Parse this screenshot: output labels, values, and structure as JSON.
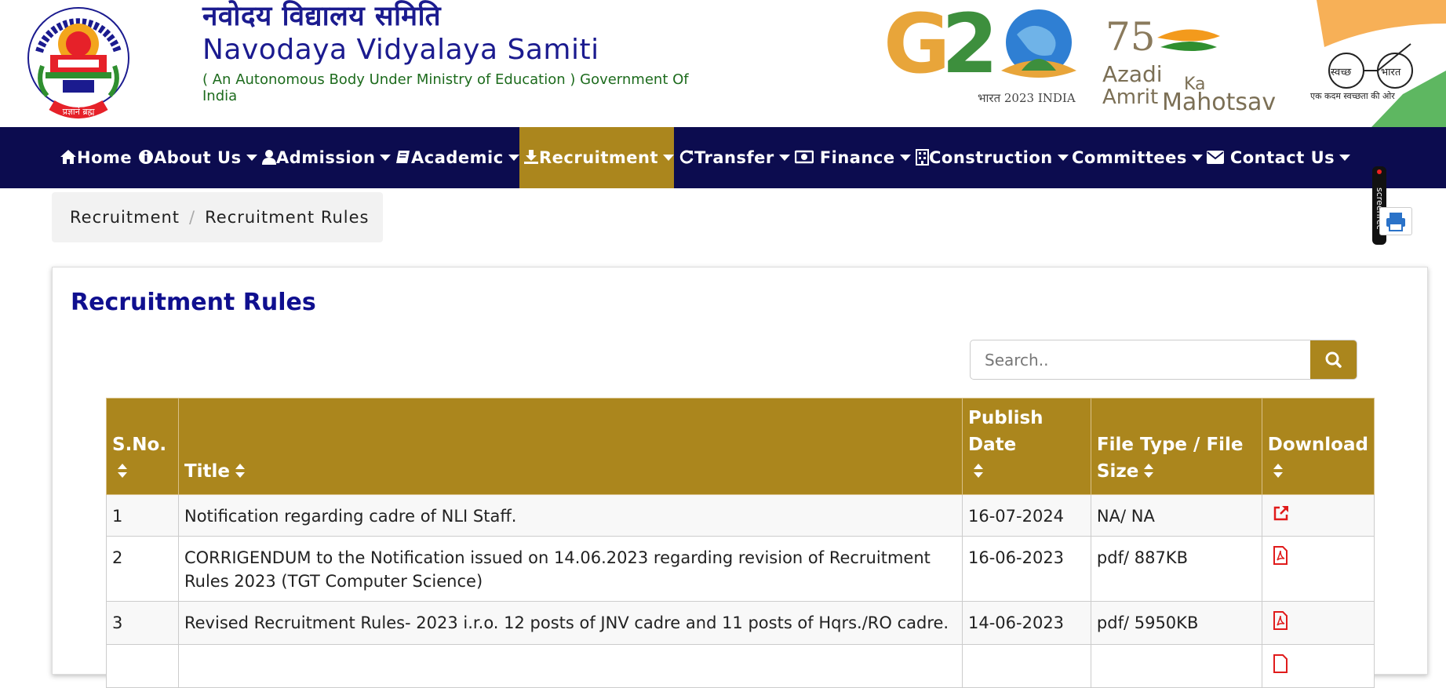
{
  "header": {
    "hindi_title": "नवोदय विद्यालय समिति",
    "english_title": "Navodaya Vidyalaya Samiti",
    "subtitle": "( An Autonomous Body Under Ministry of Education ) Government Of India",
    "emblem_motto": "प्रज्ञानं ब्रह्म",
    "emblem_ring_text": "नवोदय विद्यालय समिति",
    "g20_caption": "भारत 2023 INDIA",
    "azadi_text": [
      "Azadi",
      "Ka",
      "Amrit",
      "Mahotsav"
    ],
    "azadi_number": "75",
    "swachh_text": [
      "स्वच्छ",
      "भारत"
    ],
    "swachh_tagline": "एक कदम स्वच्छता की ओर"
  },
  "nav": {
    "items": [
      {
        "label": "Home",
        "icon": "home-icon",
        "has_caret": false
      },
      {
        "label": "About Us",
        "icon": "info-icon",
        "has_caret": true
      },
      {
        "label": "Admission",
        "icon": "user-icon",
        "has_caret": true
      },
      {
        "label": "Academic",
        "icon": "book-icon",
        "has_caret": true
      },
      {
        "label": "Recruitment",
        "icon": "download-icon",
        "has_caret": true,
        "active": true
      },
      {
        "label": "Transfer",
        "icon": "refresh-icon",
        "has_caret": true
      },
      {
        "label": "Finance",
        "icon": "money-icon",
        "has_caret": true
      },
      {
        "label": "Construction",
        "icon": "building-icon",
        "has_caret": true
      },
      {
        "label": "Committees",
        "icon": "",
        "has_caret": true
      },
      {
        "label": "Contact Us",
        "icon": "envelope-icon",
        "has_caret": true
      }
    ],
    "active_color": "#ab861d",
    "bg_color": "#0c0c4f"
  },
  "breadcrumb": {
    "items": [
      "Recruitment",
      "Recruitment Rules"
    ],
    "separator": "/"
  },
  "screenrec": {
    "label": "screenrec"
  },
  "main": {
    "title": "Recruitment Rules",
    "search": {
      "placeholder": "Search..",
      "value": ""
    },
    "table": {
      "columns": [
        "S.No.",
        "Title",
        "Publish Date",
        "File Type / File Size",
        "Download"
      ],
      "rows": [
        {
          "sno": "1",
          "title": "Notification regarding cadre of NLI Staff.",
          "date": "16-07-2024",
          "file": "NA/ NA",
          "download_icon": "external-link-icon"
        },
        {
          "sno": "2",
          "title": "CORRIGENDUM to the Notification issued on 14.06.2023 regarding revision of Recruitment Rules 2023 (TGT Computer Science)",
          "date": "16-06-2023",
          "file": "pdf/ 887KB",
          "download_icon": "pdf-icon"
        },
        {
          "sno": "3",
          "title": "Revised Recruitment Rules- 2023 i.r.o. 12 posts of JNV cadre and 11 posts of Hqrs./RO cadre.",
          "date": "14-06-2023",
          "file": "pdf/ 5950KB",
          "download_icon": "pdf-icon"
        },
        {
          "sno": "",
          "title": "",
          "date": "",
          "file": "",
          "download_icon": "pdf-icon"
        }
      ]
    }
  }
}
